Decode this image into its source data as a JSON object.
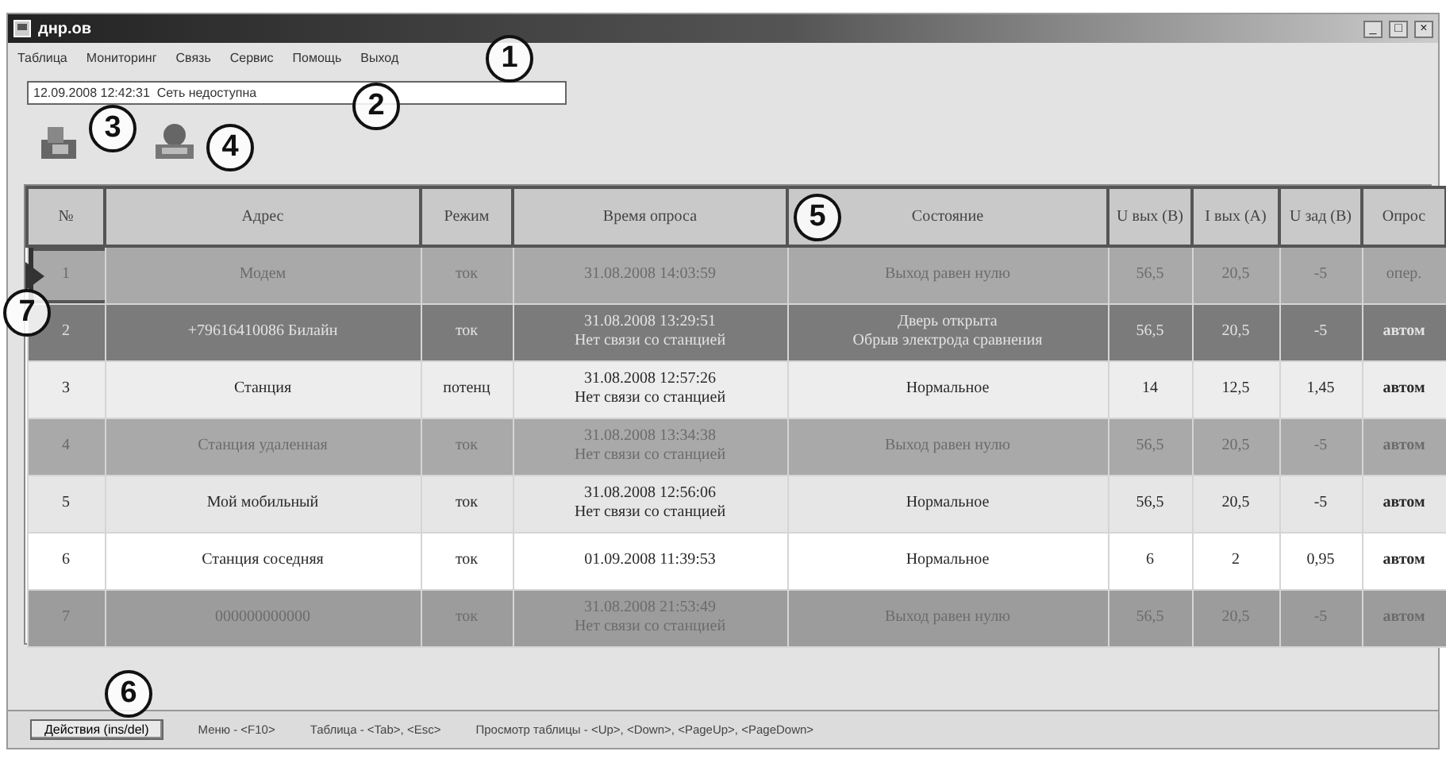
{
  "window": {
    "title": "днр.ов",
    "controls": [
      "_",
      "□",
      "×"
    ]
  },
  "menu": [
    "Таблица",
    "Мониторинг",
    "Связь",
    "Сервис",
    "Помощь",
    "Выход"
  ],
  "status_field": {
    "value": "12.09.2008 12:42:31  Сеть недоступна"
  },
  "callouts": [
    "1",
    "2",
    "3",
    "4",
    "5",
    "6",
    "7"
  ],
  "table": {
    "columns": [
      "№",
      "Адрес",
      "Режим",
      "Время опроса",
      "Состояние",
      "U вых (В)",
      "I вых (А)",
      "U зад (В)",
      "Опрос"
    ],
    "rows": [
      {
        "selected": true,
        "color": "#a9a9a9",
        "cells": [
          "1",
          "Модем",
          "ток",
          [
            "31.08.2008 14:03:59"
          ],
          [
            "Выход равен нулю"
          ],
          "56,5",
          "20,5",
          "-5",
          "опер."
        ]
      },
      {
        "selected": false,
        "color": "#7b7b7b",
        "cells": [
          "2",
          "+79616410086 Билайн",
          "ток",
          [
            "31.08.2008 13:29:51",
            "Нет связи со станцией"
          ],
          [
            "Дверь открыта",
            "Обрыв электрода сравнения"
          ],
          "56,5",
          "20,5",
          "-5",
          "автом"
        ]
      },
      {
        "selected": false,
        "color": "#ededed",
        "cells": [
          "3",
          "Станция",
          "потенц",
          [
            "31.08.2008 12:57:26",
            "Нет связи со станцией"
          ],
          [
            "Нормальное"
          ],
          "14",
          "12,5",
          "1,45",
          "автом"
        ]
      },
      {
        "selected": false,
        "color": "#a9a9a9",
        "cells": [
          "4",
          "Станция удаленная",
          "ток",
          [
            "31.08.2008 13:34:38",
            "Нет связи со станцией"
          ],
          [
            "Выход равен нулю"
          ],
          "56,5",
          "20,5",
          "-5",
          "автом"
        ]
      },
      {
        "selected": false,
        "color": "#e6e6e6",
        "cells": [
          "5",
          "Мой мобильный",
          "ток",
          [
            "31.08.2008 12:56:06",
            "Нет связи со станцией"
          ],
          [
            "Нормальное"
          ],
          "56,5",
          "20,5",
          "-5",
          "автом"
        ]
      },
      {
        "selected": false,
        "color": "#ffffff",
        "cells": [
          "6",
          "Станция соседняя",
          "ток",
          [
            "01.09.2008 11:39:53"
          ],
          [
            "Нормальное"
          ],
          "6",
          "2",
          "0,95",
          "автом"
        ]
      },
      {
        "selected": false,
        "color": "#9c9c9c",
        "cells": [
          "7",
          "000000000000",
          "ток",
          [
            "31.08.2008 21:53:49",
            "Нет связи со станцией"
          ],
          [
            "Выход равен нулю"
          ],
          "56,5",
          "20,5",
          "-5",
          "автом"
        ]
      }
    ]
  },
  "bottom_bar": {
    "button": "Действия (ins/del)",
    "hints": [
      "Меню - <F10>",
      "Таблица - <Tab>, <Esc>",
      "Просмотр таблицы - <Up>, <Down>, <PageUp>, <PageDown>"
    ]
  }
}
